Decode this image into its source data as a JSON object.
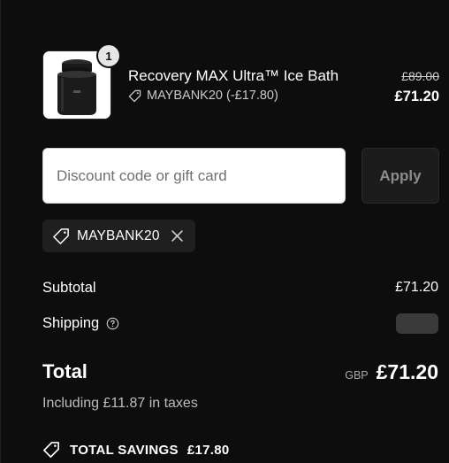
{
  "colors": {
    "background": "#0d0d0d",
    "input_background": "#ffffff",
    "apply_button_background": "#1c1c1c",
    "chip_background": "#1f1f1f",
    "muted_text": "#bdbdbd"
  },
  "product": {
    "name": "Recovery MAX Ultra™ Ice Bath",
    "quantity": "1",
    "discount_text": "MAYBANK20 (-£17.80)",
    "original_price": "£89.00",
    "price": "£71.20",
    "image_icon": "ice-bath-product-image"
  },
  "discount_form": {
    "placeholder": "Discount code or gift card",
    "value": "",
    "apply_label": "Apply"
  },
  "applied_code": {
    "label": "MAYBANK20",
    "icon": "tag-icon",
    "remove_icon": "close-icon"
  },
  "summary": {
    "subtotal_label": "Subtotal",
    "subtotal_value": "£71.20",
    "shipping_label": "Shipping",
    "shipping_help_icon": "question-circle-icon",
    "total_label": "Total",
    "currency": "GBP",
    "total_value": "£71.20",
    "taxes_note": "Including £11.87 in taxes"
  },
  "savings": {
    "label": "TOTAL SAVINGS",
    "amount": "£17.80"
  }
}
